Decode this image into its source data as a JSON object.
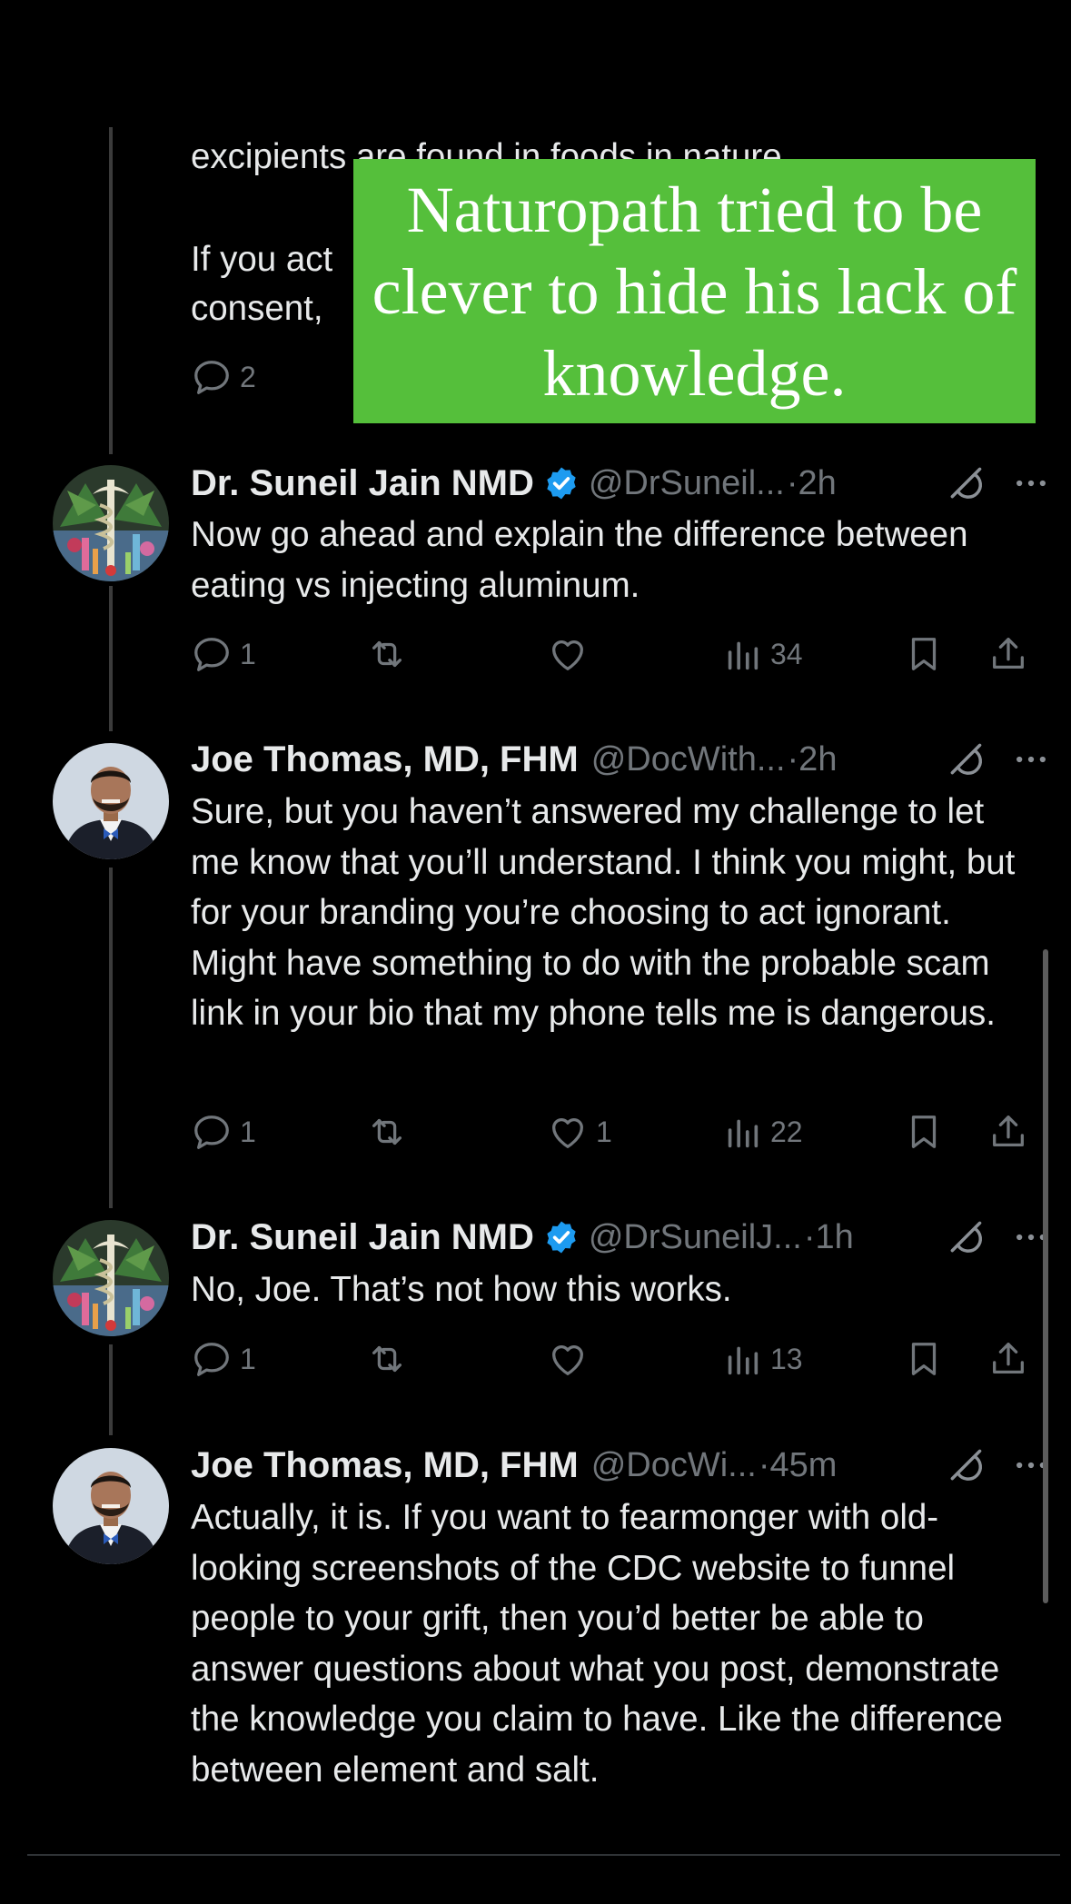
{
  "top_partial": {
    "line1": "excipients are found in foods in nature.",
    "line2": "If you act",
    "line3": "consent,",
    "reply_count": "2"
  },
  "overlay": {
    "text": "Naturopath tried to be clever to hide his lack of knowledge."
  },
  "tweets": [
    {
      "name": "Dr. Suneil Jain NMD",
      "handle": "@DrSuneil...",
      "time": "·2h",
      "text": "Now go ahead and explain the difference between eating vs injecting aluminum.",
      "replies": "1",
      "retweets": "",
      "likes": "",
      "views": "34"
    },
    {
      "name": "Joe Thomas, MD, FHM",
      "handle": "@DocWith...",
      "time": "·2h",
      "text": "Sure, but you haven’t answered my challenge to let me know that you’ll understand. I think you might, but for your branding you’re choosing to act ignorant. Might have something to do with the probable scam link in your bio that my phone tells me is dangerous.",
      "replies": "1",
      "retweets": "",
      "likes": "1",
      "views": "22"
    },
    {
      "name": "Dr. Suneil Jain NMD",
      "handle": "@DrSuneilJ...",
      "time": "·1h",
      "text": "No, Joe. That’s not how this works.",
      "replies": "1",
      "retweets": "",
      "likes": "",
      "views": "13"
    },
    {
      "name": "Joe Thomas, MD, FHM",
      "handle": "@DocWi...",
      "time": "·45m",
      "text": "Actually, it is. If you want to fearmonger with old-looking screenshots of the CDC website to funnel people to your grift, then you’d better be able to answer questions about what you post, demonstrate the knowledge you claim to have. Like the difference between element and salt."
    }
  ],
  "colors": {
    "background": "#000000",
    "text": "#e7e9ea",
    "muted": "#71767b",
    "verified": "#1d9bf0",
    "overlay": "#55bf3b"
  }
}
